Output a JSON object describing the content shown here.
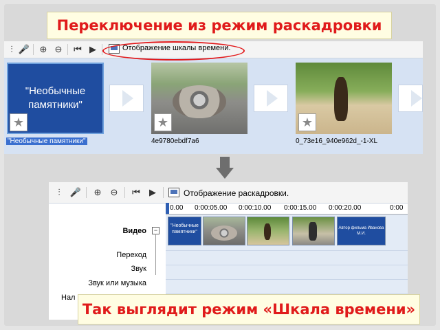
{
  "captions": {
    "top": "Переключение из режим раскадровки",
    "bottom": "Так выглядит режим «Шкала времени»"
  },
  "storyboard": {
    "toolbar_label": "Отображение шкалы времени.",
    "tiles": [
      {
        "thumb_text": "\"Необычные памятники\"",
        "label": "\"Необычные памятники\""
      },
      {
        "label": "4e9780ebdf7a6"
      },
      {
        "label": "0_73e16_940e962d_-1-XL"
      }
    ],
    "star_glyph": "★"
  },
  "timeline": {
    "toolbar_label": "Отображение раскадровки.",
    "ticks": [
      "0.00",
      "0:00:05.00",
      "0:00:10.00",
      "0:00:15.00",
      "0:00:20.00",
      "0:00"
    ],
    "tracks": {
      "video": "Видео",
      "transition": "Переход",
      "audio": "Звук",
      "music": "Звук или музыка",
      "overlay": "Нал"
    },
    "clips": {
      "title_text": "\"Необычные памятники\"",
      "credits_text": "Автор фильма Иванова М.И."
    }
  },
  "icons": [
    "storyboard-icon",
    "microphone-icon",
    "zoom-in-icon",
    "zoom-out-icon",
    "rewind-icon",
    "play-icon",
    "view-toggle-icon"
  ],
  "colors": {
    "caption_text": "#e01b1b",
    "caption_bg": "#fffde2",
    "highlight": "#e2191b",
    "title_clip": "#1f4da0"
  }
}
